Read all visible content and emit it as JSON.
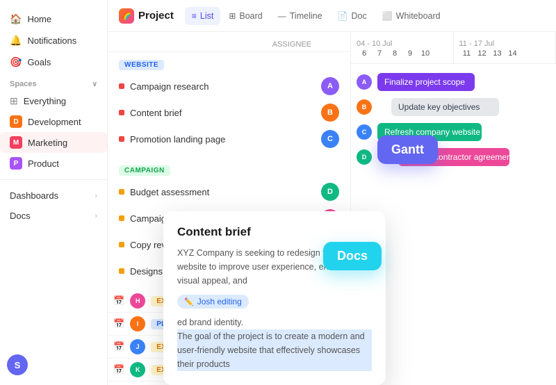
{
  "sidebar": {
    "nav": [
      {
        "id": "home",
        "label": "Home",
        "icon": "🏠"
      },
      {
        "id": "notifications",
        "label": "Notifications",
        "icon": "🔔"
      },
      {
        "id": "goals",
        "label": "Goals",
        "icon": "🎯"
      }
    ],
    "spaces_title": "Spaces",
    "spaces": [
      {
        "id": "everything",
        "label": "Everything",
        "type": "everything"
      },
      {
        "id": "development",
        "label": "Development",
        "type": "dev",
        "letter": "D"
      },
      {
        "id": "marketing",
        "label": "Marketing",
        "type": "mkt",
        "letter": "M",
        "active": true
      },
      {
        "id": "product",
        "label": "Product",
        "type": "prd",
        "letter": "P"
      }
    ],
    "bottom": [
      {
        "id": "dashboards",
        "label": "Dashboards"
      },
      {
        "id": "docs",
        "label": "Docs"
      }
    ],
    "user_initial": "S"
  },
  "topbar": {
    "project_label": "Project",
    "tabs": [
      {
        "id": "list",
        "label": "List",
        "icon": "≡",
        "active": true
      },
      {
        "id": "board",
        "label": "Board",
        "icon": "⊞"
      },
      {
        "id": "timeline",
        "label": "Timeline",
        "icon": "—"
      },
      {
        "id": "doc",
        "label": "Doc",
        "icon": "📄"
      },
      {
        "id": "whiteboard",
        "label": "Whiteboard",
        "icon": "⬜"
      }
    ]
  },
  "table_header": {
    "assignee": "ASSIGNEE"
  },
  "website_section": {
    "badge": "WEBSITE",
    "tasks": [
      {
        "name": "Campaign research",
        "dot": "red"
      },
      {
        "name": "Content brief",
        "dot": "red"
      },
      {
        "name": "Promotion landing page",
        "dot": "red"
      }
    ]
  },
  "campaign_section": {
    "badge": "CAMPAIGN",
    "tasks": [
      {
        "name": "Budget assessment",
        "dot": "yellow"
      },
      {
        "name": "Campaign kickoff",
        "dot": "yellow"
      },
      {
        "name": "Copy review",
        "dot": "yellow"
      },
      {
        "name": "Designs",
        "dot": "yellow"
      }
    ]
  },
  "gantt": {
    "label": "Gantt",
    "date_range_1": "04 - 10 Jul",
    "date_range_2": "11 - 17 Jul",
    "dates_1": [
      "6",
      "7",
      "8",
      "9",
      "10"
    ],
    "dates_2": [
      "11",
      "12",
      "13",
      "14"
    ],
    "bars": [
      {
        "label": "Finalize project scope",
        "color": "purple"
      },
      {
        "label": "Update key objectives",
        "color": "gray"
      },
      {
        "label": "Refresh company website",
        "color": "green"
      },
      {
        "label": "Update contractor agreement",
        "color": "pink"
      }
    ]
  },
  "docs": {
    "label": "Docs",
    "title": "Content brief",
    "body1": "XYZ Company is seeking to redesign their existing website to improve user experience, enhance visual appeal, and",
    "editing_user": "Josh editing",
    "body2": "ed brand identity.",
    "body3": "The goal of the project is to create a modern and user-friendly website that effectively showcases their products"
  },
  "status_rows": [
    {
      "status": "EXECUTION"
    },
    {
      "status": "PLANNING"
    },
    {
      "status": "EXECUTION"
    },
    {
      "status": "EXECUTION"
    }
  ],
  "colors": {
    "accent_blue": "#6366f1",
    "accent_cyan": "#22d3ee"
  }
}
